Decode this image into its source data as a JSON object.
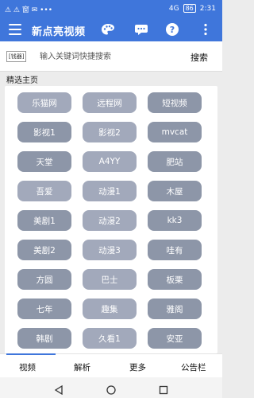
{
  "status": {
    "left_text": "⚠ ⚠ 窗 ✉ •••",
    "network": "4G",
    "battery": "86",
    "time": "2:31"
  },
  "app": {
    "title": "新点亮视频",
    "icons": [
      "menu-icon",
      "palette-icon",
      "chat-icon",
      "help-icon",
      "more-icon"
    ]
  },
  "search": {
    "tag": "[钱器]",
    "placeholder": "输入关键词快捷搜索",
    "button": "搜索"
  },
  "section_title": "精选主页",
  "chips": [
    {
      "label": "乐猫网"
    },
    {
      "label": "远程网"
    },
    {
      "label": "短视频"
    },
    {
      "label": "影视1"
    },
    {
      "label": "影视2"
    },
    {
      "label": "mvcat"
    },
    {
      "label": "天堂"
    },
    {
      "label": "A4YY"
    },
    {
      "label": "肥站"
    },
    {
      "label": "吾爱"
    },
    {
      "label": "动漫1"
    },
    {
      "label": "木屋"
    },
    {
      "label": "美剧1"
    },
    {
      "label": "动漫2"
    },
    {
      "label": "kk3"
    },
    {
      "label": "美剧2"
    },
    {
      "label": "动漫3"
    },
    {
      "label": "哇有"
    },
    {
      "label": "方圆"
    },
    {
      "label": "巴士"
    },
    {
      "label": "板栗"
    },
    {
      "label": "七年"
    },
    {
      "label": "趣集"
    },
    {
      "label": "雅阁"
    },
    {
      "label": "韩剧"
    },
    {
      "label": "久看1"
    },
    {
      "label": "安亚"
    }
  ],
  "tabs": [
    "视频",
    "解析",
    "更多",
    "公告栏"
  ],
  "colors": {
    "accent": "#3f76db",
    "chip": "#a2a9bb",
    "chip_dark": "#8d96a8"
  }
}
